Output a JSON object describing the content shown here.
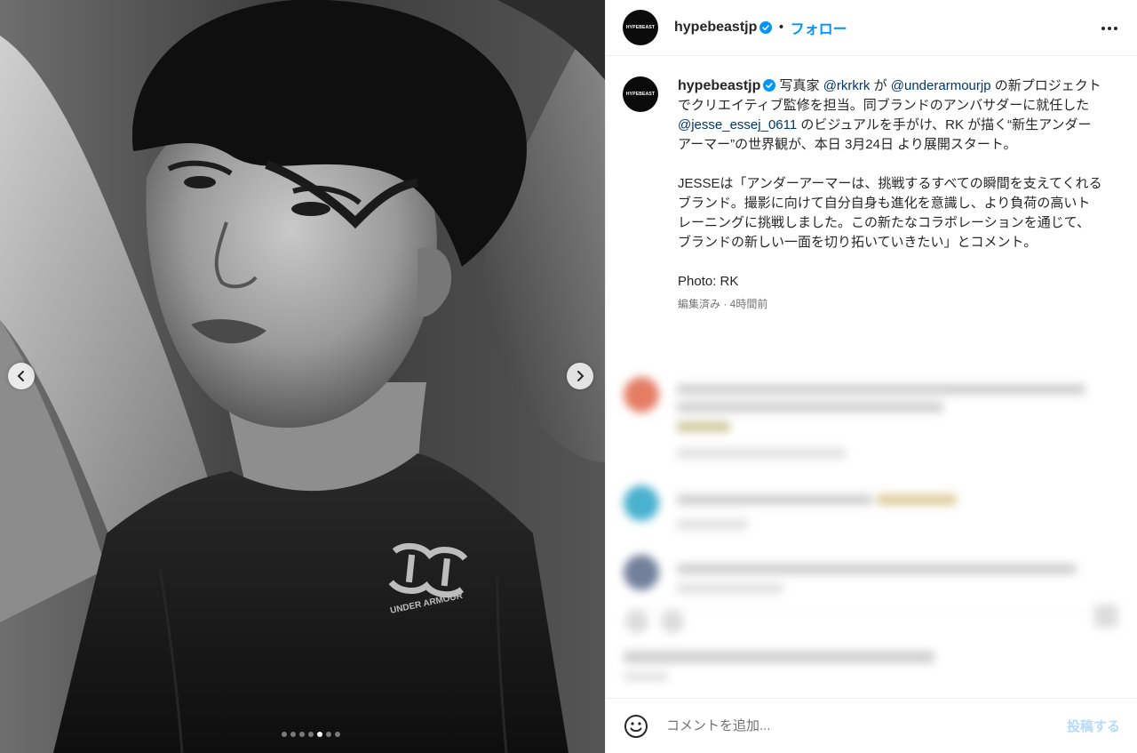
{
  "post": {
    "image_alt": "Black and white portrait",
    "shirt_logo_text": "UNDER ARMOUR",
    "carousel": {
      "total": 7,
      "active_index": 4
    }
  },
  "header": {
    "username": "hypebeastjp",
    "separator": "•",
    "follow_label": "フォロー",
    "avatar_logo": "HYPEBEAST",
    "more_icon": "more-horizontal-icon"
  },
  "caption": {
    "username": "hypebeastjp",
    "p1": {
      "t1": " 写真家 ",
      "m1": "@rkrkrk",
      "t2": " が ",
      "m2": "@underarmourjp",
      "t3": " の新プロジェクトでクリエイティブ監修を担当。同ブランドのアンバサダーに就任した ",
      "m3": "@jesse_essej_0611",
      "t4": " のビジュアルを手がけ、RK が描く“新生アンダーアーマー”の世界観が、本日 3月24日 より展開スタート。"
    },
    "p2": "JESSEは「アンダーアーマーは、挑戦するすべての瞬間を支えてくれるブランド。撮影に向けて自分自身も進化を意識し、より負荷の高いトレーニングに挑戦しました。この新たなコラボレーションを通じて、ブランドの新しい一面を切り拓いていきたい」とコメント。",
    "p3": "Photo: RK",
    "meta": "編集済み · 4時間前"
  },
  "comment_bar": {
    "placeholder": "コメントを追加...",
    "post_label": "投稿する",
    "emoji_icon": "smiley-icon"
  },
  "colors": {
    "accent": "#0095f6",
    "mention": "#00376b",
    "post_disabled": "#b3dbff"
  }
}
